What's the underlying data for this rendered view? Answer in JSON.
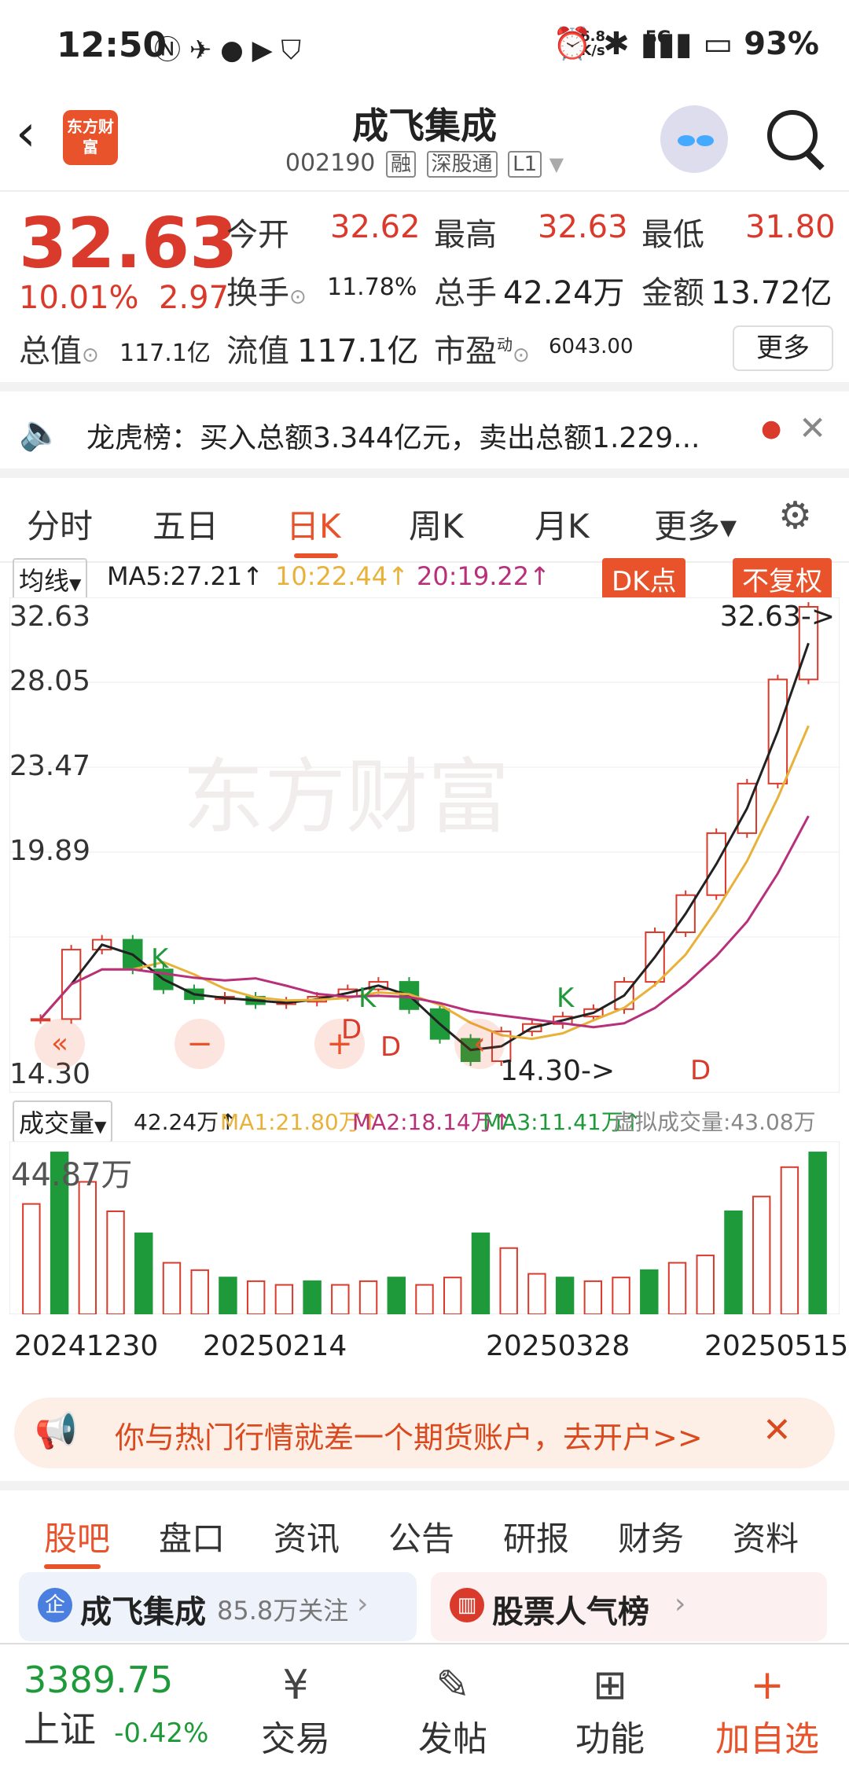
{
  "status": {
    "time": "12:50",
    "net_speed": "6.8",
    "net_unit": "K/s",
    "signal": "5G",
    "battery": "93%"
  },
  "header": {
    "logo": "东方财富",
    "title": "成飞集成",
    "code": "002190",
    "tags": [
      "融",
      "深股通",
      "L1"
    ]
  },
  "quote": {
    "price": "32.63",
    "pct": "10.01%",
    "change": "2.97",
    "open_label": "今开",
    "open": "32.62",
    "high_label": "最高",
    "high": "32.63",
    "low_label": "最低",
    "low": "31.80",
    "turnover_label": "换手",
    "turnover": "11.78%",
    "vol_label": "总手",
    "vol": "42.24万",
    "amount_label": "金额",
    "amount": "13.72亿",
    "mcap_label": "总值",
    "mcap": "117.1亿",
    "float_label": "流值",
    "float": "117.1亿",
    "pe_label": "市盈",
    "pe_sup": "动",
    "pe": "6043.00",
    "more": "更多"
  },
  "notice": {
    "text": "龙虎榜：买入总额3.344亿元，卖出总额1.229..."
  },
  "chart_tabs": [
    "分时",
    "五日",
    "日K",
    "周K",
    "月K",
    "更多▾"
  ],
  "ma": {
    "selector": "均线",
    "ma5": "MA5:27.21↑",
    "ma10": "10:22.44↑",
    "ma20": "20:19.22↑",
    "dk": "DK点",
    "fq": "不复权"
  },
  "kchart": {
    "y_labels": [
      "32.63",
      "28.05",
      "23.47",
      "19.89",
      "14.30"
    ],
    "high_tag": "32.63->",
    "low_tag": "14.30->",
    "watermark": "东方财富",
    "markers": [
      "K",
      "K",
      "K",
      "D",
      "D",
      "D"
    ]
  },
  "volume": {
    "selector": "成交量",
    "vol": "42.24万↑",
    "ma1": "MA1:21.80万↑",
    "ma2": "MA2:18.14万↑",
    "ma3": "MA3:11.41万↑",
    "virtual": "虚拟成交量:43.08万",
    "max": "44.87万"
  },
  "dates": [
    "20241230",
    "20250214",
    "20250328",
    "20250515"
  ],
  "banner": {
    "text": "你与热门行情就差一个期货账户，去开户>>"
  },
  "bottom_tabs": [
    "股吧",
    "盘口",
    "资讯",
    "公告",
    "研报",
    "财务",
    "资料"
  ],
  "cards": {
    "left_name": "成飞集成",
    "left_follow": "85.8万关注",
    "right_name": "股票人气榜"
  },
  "index": {
    "value": "3389.75",
    "name": "上证",
    "change": "-0.42%"
  },
  "nav": [
    {
      "icon": "¥",
      "label": "交易"
    },
    {
      "icon": "✎",
      "label": "发帖"
    },
    {
      "icon": "⊞",
      "label": "功能"
    },
    {
      "icon": "+",
      "label": "加自选"
    }
  ],
  "colors": {
    "up": "#d93a2b",
    "down": "#1f9a3a",
    "accent": "#e8532b",
    "ma5": "#222222",
    "ma10": "#e8b23a",
    "ma20": "#b8307a"
  },
  "chart_data": [
    {
      "type": "candlestick",
      "x": [
        "20241230",
        "20250214",
        "20250328",
        "20250515"
      ],
      "close": [
        16.0,
        18.8,
        19.2,
        18.0,
        17.2,
        16.8,
        16.9,
        16.6,
        16.7,
        16.9,
        17.2,
        17.5,
        16.4,
        15.2,
        14.3,
        15.5,
        15.8,
        16.1,
        16.4,
        17.5,
        19.5,
        21.0,
        23.5,
        25.5,
        29.7,
        32.63
      ],
      "ylim": [
        14.3,
        32.63
      ]
    },
    {
      "type": "bar",
      "series": [
        {
          "name": "成交量",
          "values": [
            30,
            44,
            36,
            28,
            22,
            14,
            12,
            10,
            9,
            8,
            9,
            8,
            9,
            10,
            8,
            10,
            22,
            18,
            11,
            10,
            9,
            10,
            12,
            14,
            16,
            28,
            32,
            40,
            44
          ]
        }
      ],
      "ylim": [
        0,
        44.87
      ]
    }
  ]
}
